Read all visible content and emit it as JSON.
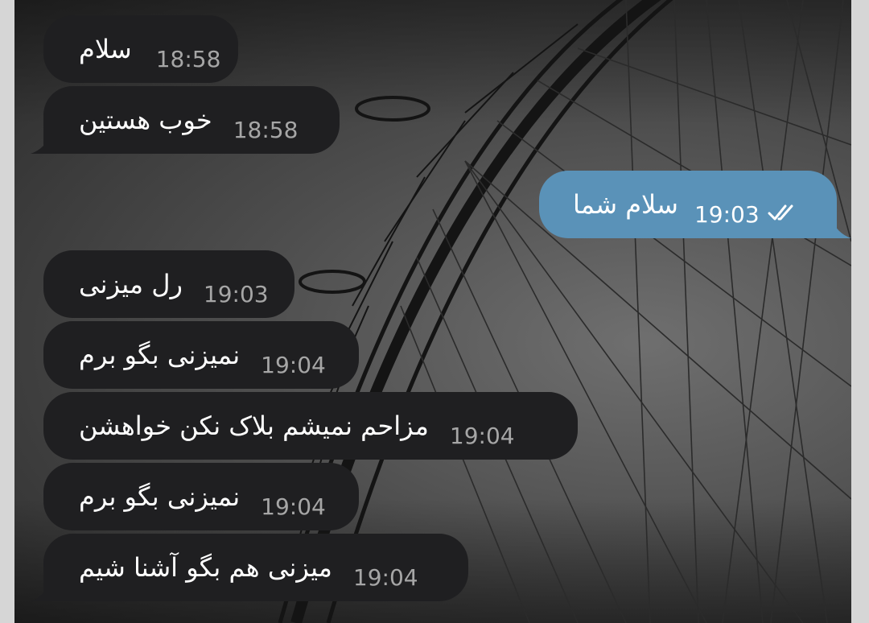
{
  "messages": [
    {
      "direction": "incoming",
      "text": "سلام",
      "time": "18:58"
    },
    {
      "direction": "incoming",
      "text": "خوب هستین",
      "time": "18:58"
    },
    {
      "direction": "outgoing",
      "text": "سلام شما",
      "time": "19:03",
      "status": "read-double-check-icon"
    },
    {
      "direction": "incoming",
      "text": "رل میزنی",
      "time": "19:03"
    },
    {
      "direction": "incoming",
      "text": "نمیزنی بگو برم",
      "time": "19:04"
    },
    {
      "direction": "incoming",
      "text": "مزاحم نمیشم بلاک نکن خواهشن",
      "time": "19:04"
    },
    {
      "direction": "incoming",
      "text": "نمیزنی بگو برم",
      "time": "19:04"
    },
    {
      "direction": "incoming",
      "text": "میزنی هم بگو آشنا شیم",
      "time": "19:04"
    }
  ],
  "colors": {
    "incoming_bubble": "#1f1f21",
    "outgoing_bubble": "#5a92b8",
    "time_text_incoming": "#a6a6a6",
    "time_text_outgoing": "#ffffff",
    "wallpaper": "grayscale ferris wheel"
  }
}
